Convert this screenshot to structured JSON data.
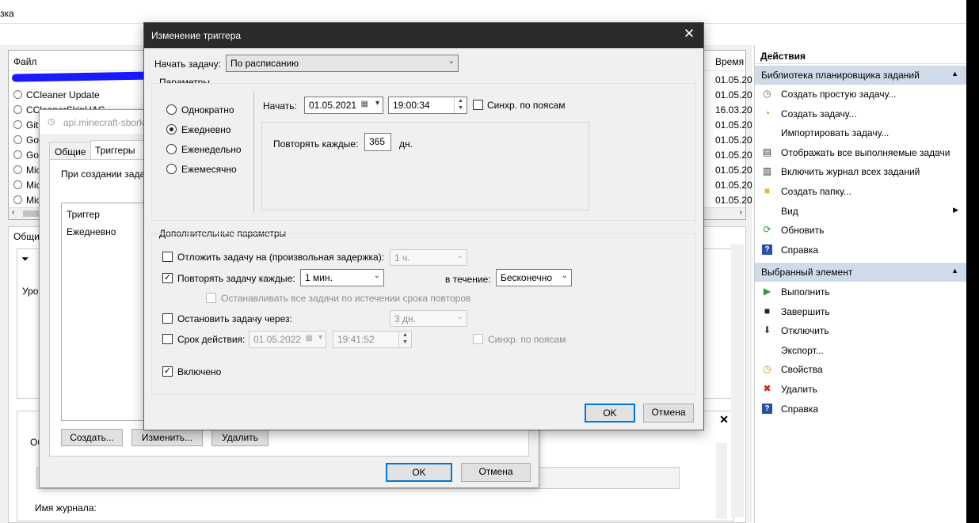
{
  "menubar": {
    "fragment": "зка"
  },
  "filelist": {
    "col_file": "Файл",
    "col_time": "Время",
    "rows": [
      {
        "name": "",
        "time": "01.05.20"
      },
      {
        "name": "CCleaner Update",
        "time": "01.05.20"
      },
      {
        "name": "CCleanerSkipUAC",
        "time": "16.03.20"
      },
      {
        "name": "Git",
        "time": "01.05.20"
      },
      {
        "name": "Goo",
        "time": "01.05.20"
      },
      {
        "name": "Goo",
        "time": "01.05.20"
      },
      {
        "name": "Mic",
        "time": "01.05.20"
      },
      {
        "name": "Mic",
        "time": "01.05.20"
      },
      {
        "name": "Mic",
        "time": "01.05.20"
      }
    ]
  },
  "lower": {
    "tab_fragment": "Общи",
    "level_fragment": "Уров",
    "ob_fragment": "Об",
    "journal_label": "Имя журнала:"
  },
  "actions": {
    "title": "Действия",
    "section1": "Библиотека планировщика заданий",
    "items1": [
      {
        "label": "Создать простую задачу...",
        "icon": "create-simple-task-icon",
        "glyph": "◷",
        "color": "#666"
      },
      {
        "label": "Создать задачу...",
        "icon": "create-task-icon",
        "glyph": "◔",
        "color": "#c88a00"
      },
      {
        "label": "Импортировать задачу...",
        "icon": "",
        "glyph": "",
        "color": "#000"
      },
      {
        "label": "Отображать все выполняемые задачи",
        "icon": "running-tasks-icon",
        "glyph": "▤",
        "color": "#333"
      },
      {
        "label": "Включить журнал всех заданий",
        "icon": "enable-log-icon",
        "glyph": "▥",
        "color": "#333"
      },
      {
        "label": "Создать папку...",
        "icon": "folder-icon",
        "glyph": "■",
        "color": "#e8b73a"
      },
      {
        "label": "Вид",
        "icon": "",
        "glyph": "",
        "color": "#000"
      },
      {
        "label": "Обновить",
        "icon": "refresh-icon",
        "glyph": "⟳",
        "color": "#2a9d2a"
      },
      {
        "label": "Справка",
        "icon": "help-icon",
        "glyph": "?",
        "color": "#fff"
      }
    ],
    "section2": "Выбранный элемент",
    "items2": [
      {
        "label": "Выполнить",
        "icon": "run-icon",
        "glyph": "▶",
        "color": "#2a9d2a"
      },
      {
        "label": "Завершить",
        "icon": "stop-icon",
        "glyph": "■",
        "color": "#222"
      },
      {
        "label": "Отключить",
        "icon": "disable-icon",
        "glyph": "⬇",
        "color": "#444"
      },
      {
        "label": "Экспорт...",
        "icon": "",
        "glyph": "",
        "color": "#000"
      },
      {
        "label": "Свойства",
        "icon": "properties-icon",
        "glyph": "◷",
        "color": "#c88a00"
      },
      {
        "label": "Удалить",
        "icon": "delete-icon",
        "glyph": "✖",
        "color": "#d42020"
      },
      {
        "label": "Справка",
        "icon": "help-icon",
        "glyph": "?",
        "color": "#fff"
      }
    ]
  },
  "dialog2": {
    "title": "api.minecraft-sbork",
    "tab_general": "Общие",
    "tab_triggers": "Триггеры",
    "created_text": "При создании задач",
    "col_trigger": "Триггер",
    "row_trigger": "Ежедневно",
    "btn_create": "Создать...",
    "btn_edit": "Изменить...",
    "btn_delete": "Удалить",
    "btn_ok": "OK",
    "btn_cancel": "Отмена"
  },
  "dialog": {
    "title": "Изменение триггера",
    "start_task_label": "Начать задачу:",
    "start_task_value": "По расписанию",
    "params_label": "Параметры",
    "radio_once": "Однократно",
    "radio_daily": "Ежедневно",
    "radio_weekly": "Еженедельно",
    "radio_monthly": "Ежемесячно",
    "start_label": "Начать:",
    "start_date": "01.05.2021",
    "start_time": "19:00:34",
    "sync_tz": "Синхр. по поясам",
    "repeat_every_label": "Повторять каждые:",
    "repeat_every_value": "365",
    "repeat_every_unit": "дн.",
    "advanced_label": "Дополнительные параметры",
    "delay_label": "Отложить задачу на (произвольная задержка):",
    "delay_value": "1 ч.",
    "repeat_task_label": "Повторять задачу каждые:",
    "repeat_task_value": "1 мин.",
    "duration_label": "в течение:",
    "duration_value": "Бесконечно",
    "stop_all_label": "Останавливать все задачи по истечении срока повторов",
    "stop_after_label": "Остановить задачу через:",
    "stop_after_value": "3 дн.",
    "expire_label": "Срок действия:",
    "expire_date": "01.05.2022",
    "expire_time": "19:41:52",
    "expire_sync": "Синхр. по поясам",
    "enabled_label": "Включено",
    "ok": "OK",
    "cancel": "Отмена"
  }
}
